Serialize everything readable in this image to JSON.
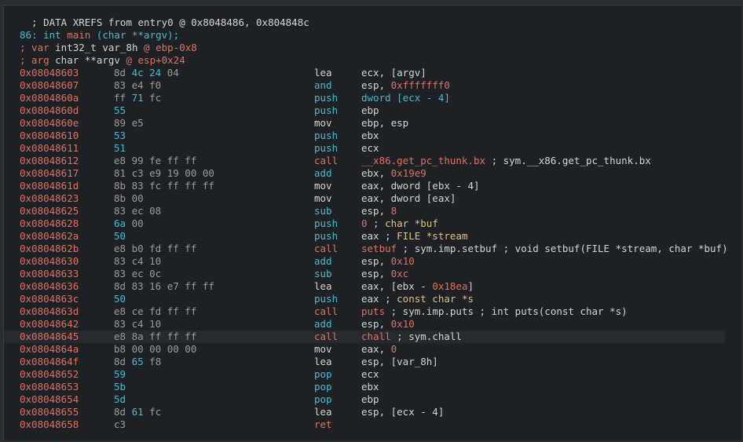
{
  "colors": {
    "background": "#1e2125",
    "address": "#e0705a",
    "cyan": "#4ab8cc",
    "orange": "#e0705a",
    "text": "#d4d4d4"
  },
  "header": [
    [
      {
        "t": "  ; DATA XREFS from entry0 @ 0x8048486, 0x804848c",
        "c": "white"
      }
    ],
    [
      {
        "t": "86: int ",
        "c": "cyan"
      },
      {
        "t": "main",
        "c": "orange"
      },
      {
        "t": " (char **argv);",
        "c": "cyan"
      }
    ],
    [
      {
        "t": "; var ",
        "c": "orange"
      },
      {
        "t": "int32_t var_8h",
        "c": "white"
      },
      {
        "t": " @ ebp-0x8",
        "c": "orange"
      }
    ],
    [
      {
        "t": "; arg ",
        "c": "orange"
      },
      {
        "t": "char **argv",
        "c": "white"
      },
      {
        "t": " @ esp+0x24",
        "c": "orange"
      }
    ]
  ],
  "instructions": [
    {
      "addr": "0x08048603",
      "bytes": [
        {
          "t": "8d ",
          "c": "grey"
        },
        {
          "t": "4c 24",
          "c": "cyan"
        },
        {
          "t": " 04",
          "c": "grey"
        }
      ],
      "mnem": "lea",
      "mc": "white",
      "ops": [
        {
          "t": "ecx, [argv]",
          "c": "white"
        }
      ]
    },
    {
      "addr": "0x08048607",
      "bytes": [
        {
          "t": "83 e4 f0",
          "c": "grey"
        }
      ],
      "mnem": "and",
      "mc": "cyan",
      "ops": [
        {
          "t": "esp, ",
          "c": "white"
        },
        {
          "t": "0xfffffff0",
          "c": "orange"
        }
      ]
    },
    {
      "addr": "0x0804860a",
      "bytes": [
        {
          "t": "ff ",
          "c": "grey"
        },
        {
          "t": "71",
          "c": "cyan"
        },
        {
          "t": " fc",
          "c": "grey"
        }
      ],
      "mnem": "push",
      "mc": "cyan",
      "ops": [
        {
          "t": "dword [ecx - 4]",
          "c": "cyan"
        }
      ]
    },
    {
      "addr": "0x0804860d",
      "bytes": [
        {
          "t": "55",
          "c": "cyan"
        }
      ],
      "mnem": "push",
      "mc": "cyan",
      "ops": [
        {
          "t": "ebp",
          "c": "white"
        }
      ]
    },
    {
      "addr": "0x0804860e",
      "bytes": [
        {
          "t": "89 e5",
          "c": "grey"
        }
      ],
      "mnem": "mov",
      "mc": "white",
      "ops": [
        {
          "t": "ebp, esp",
          "c": "white"
        }
      ]
    },
    {
      "addr": "0x08048610",
      "bytes": [
        {
          "t": "53",
          "c": "cyan"
        }
      ],
      "mnem": "push",
      "mc": "cyan",
      "ops": [
        {
          "t": "ebx",
          "c": "white"
        }
      ]
    },
    {
      "addr": "0x08048611",
      "bytes": [
        {
          "t": "51",
          "c": "cyan"
        }
      ],
      "mnem": "push",
      "mc": "cyan",
      "ops": [
        {
          "t": "ecx",
          "c": "white"
        }
      ]
    },
    {
      "addr": "0x08048612",
      "bytes": [
        {
          "t": "e8 99 fe ff ff",
          "c": "grey"
        }
      ],
      "mnem": "call",
      "mc": "orange",
      "ops": [
        {
          "t": "__x86.get_pc_thunk.bx",
          "c": "orange"
        },
        {
          "t": " ; sym.__x86.get_pc_thunk.bx",
          "c": "white"
        }
      ]
    },
    {
      "addr": "0x08048617",
      "bytes": [
        {
          "t": "81 c3 e9 19 00 00",
          "c": "grey"
        }
      ],
      "mnem": "add",
      "mc": "cyan",
      "ops": [
        {
          "t": "ebx, ",
          "c": "white"
        },
        {
          "t": "0x19e9",
          "c": "orange"
        }
      ]
    },
    {
      "addr": "0x0804861d",
      "bytes": [
        {
          "t": "8b 83 fc ff ff ff",
          "c": "grey"
        }
      ],
      "mnem": "mov",
      "mc": "white",
      "ops": [
        {
          "t": "eax, dword [ebx - 4]",
          "c": "white"
        }
      ]
    },
    {
      "addr": "0x08048623",
      "bytes": [
        {
          "t": "8b 00",
          "c": "grey"
        }
      ],
      "mnem": "mov",
      "mc": "white",
      "ops": [
        {
          "t": "eax, dword [eax]",
          "c": "white"
        }
      ]
    },
    {
      "addr": "0x08048625",
      "bytes": [
        {
          "t": "83 ec 08",
          "c": "grey"
        }
      ],
      "mnem": "sub",
      "mc": "cyan",
      "ops": [
        {
          "t": "esp, ",
          "c": "white"
        },
        {
          "t": "8",
          "c": "orange"
        }
      ]
    },
    {
      "addr": "0x08048628",
      "bytes": [
        {
          "t": "6a",
          "c": "cyan"
        },
        {
          "t": " 00",
          "c": "grey"
        }
      ],
      "mnem": "push",
      "mc": "cyan",
      "ops": [
        {
          "t": "0",
          "c": "orange"
        },
        {
          "t": " ; ",
          "c": "white"
        },
        {
          "t": "char *buf",
          "c": "yellow"
        }
      ]
    },
    {
      "addr": "0x0804862a",
      "bytes": [
        {
          "t": "50",
          "c": "cyan"
        }
      ],
      "mnem": "push",
      "mc": "cyan",
      "ops": [
        {
          "t": "eax ; ",
          "c": "white"
        },
        {
          "t": "FILE *stream",
          "c": "yellow"
        }
      ]
    },
    {
      "addr": "0x0804862b",
      "bytes": [
        {
          "t": "e8 b0 fd ff ff",
          "c": "grey"
        }
      ],
      "mnem": "call",
      "mc": "orange",
      "ops": [
        {
          "t": "setbuf",
          "c": "orange"
        },
        {
          "t": " ; sym.imp.setbuf ; void setbuf(FILE *stream, char *buf)",
          "c": "white"
        }
      ]
    },
    {
      "addr": "0x08048630",
      "bytes": [
        {
          "t": "83 c4 10",
          "c": "grey"
        }
      ],
      "mnem": "add",
      "mc": "cyan",
      "ops": [
        {
          "t": "esp, ",
          "c": "white"
        },
        {
          "t": "0x10",
          "c": "orange"
        }
      ]
    },
    {
      "addr": "0x08048633",
      "bytes": [
        {
          "t": "83 ec 0c",
          "c": "grey"
        }
      ],
      "mnem": "sub",
      "mc": "cyan",
      "ops": [
        {
          "t": "esp, ",
          "c": "white"
        },
        {
          "t": "0xc",
          "c": "orange"
        }
      ]
    },
    {
      "addr": "0x08048636",
      "bytes": [
        {
          "t": "8d 83 16 e7 ff ff",
          "c": "grey"
        }
      ],
      "mnem": "lea",
      "mc": "white",
      "ops": [
        {
          "t": "eax, [ebx - ",
          "c": "white"
        },
        {
          "t": "0x18ea",
          "c": "orange"
        },
        {
          "t": "]",
          "c": "white"
        }
      ]
    },
    {
      "addr": "0x0804863c",
      "bytes": [
        {
          "t": "50",
          "c": "cyan"
        }
      ],
      "mnem": "push",
      "mc": "cyan",
      "ops": [
        {
          "t": "eax ; ",
          "c": "white"
        },
        {
          "t": "const char *s",
          "c": "yellow"
        }
      ]
    },
    {
      "addr": "0x0804863d",
      "bytes": [
        {
          "t": "e8 ce fd ff ff",
          "c": "grey"
        }
      ],
      "mnem": "call",
      "mc": "orange",
      "ops": [
        {
          "t": "puts",
          "c": "orange"
        },
        {
          "t": " ; sym.imp.puts ; int puts(const char *s)",
          "c": "white"
        }
      ]
    },
    {
      "addr": "0x08048642",
      "bytes": [
        {
          "t": "83 c4 10",
          "c": "grey"
        }
      ],
      "mnem": "add",
      "mc": "cyan",
      "ops": [
        {
          "t": "esp, ",
          "c": "white"
        },
        {
          "t": "0x10",
          "c": "orange"
        }
      ]
    },
    {
      "addr": "0x08048645",
      "bytes": [
        {
          "t": "e8 8a ff ff ff",
          "c": "grey"
        }
      ],
      "mnem": "call",
      "mc": "orange",
      "ops": [
        {
          "t": "chall",
          "c": "orange"
        },
        {
          "t": " ; sym.chall",
          "c": "white"
        }
      ],
      "highlight": true
    },
    {
      "addr": "0x0804864a",
      "bytes": [
        {
          "t": "b8 00 00 00 00",
          "c": "grey"
        }
      ],
      "mnem": "mov",
      "mc": "white",
      "ops": [
        {
          "t": "eax, ",
          "c": "white"
        },
        {
          "t": "0",
          "c": "orange"
        }
      ]
    },
    {
      "addr": "0x0804864f",
      "bytes": [
        {
          "t": "8d ",
          "c": "grey"
        },
        {
          "t": "65",
          "c": "cyan"
        },
        {
          "t": " f8",
          "c": "grey"
        }
      ],
      "mnem": "lea",
      "mc": "white",
      "ops": [
        {
          "t": "esp, [var_8h]",
          "c": "white"
        }
      ]
    },
    {
      "addr": "0x08048652",
      "bytes": [
        {
          "t": "59",
          "c": "cyan"
        }
      ],
      "mnem": "pop",
      "mc": "cyan",
      "ops": [
        {
          "t": "ecx",
          "c": "white"
        }
      ]
    },
    {
      "addr": "0x08048653",
      "bytes": [
        {
          "t": "5b",
          "c": "cyan"
        }
      ],
      "mnem": "pop",
      "mc": "cyan",
      "ops": [
        {
          "t": "ebx",
          "c": "white"
        }
      ]
    },
    {
      "addr": "0x08048654",
      "bytes": [
        {
          "t": "5d",
          "c": "cyan"
        }
      ],
      "mnem": "pop",
      "mc": "cyan",
      "ops": [
        {
          "t": "ebp",
          "c": "white"
        }
      ]
    },
    {
      "addr": "0x08048655",
      "bytes": [
        {
          "t": "8d ",
          "c": "grey"
        },
        {
          "t": "61",
          "c": "cyan"
        },
        {
          "t": " fc",
          "c": "grey"
        }
      ],
      "mnem": "lea",
      "mc": "white",
      "ops": [
        {
          "t": "esp, [ecx - 4]",
          "c": "white"
        }
      ]
    },
    {
      "addr": "0x08048658",
      "bytes": [
        {
          "t": "c3",
          "c": "grey"
        }
      ],
      "mnem": "ret",
      "mc": "orange",
      "ops": []
    }
  ]
}
